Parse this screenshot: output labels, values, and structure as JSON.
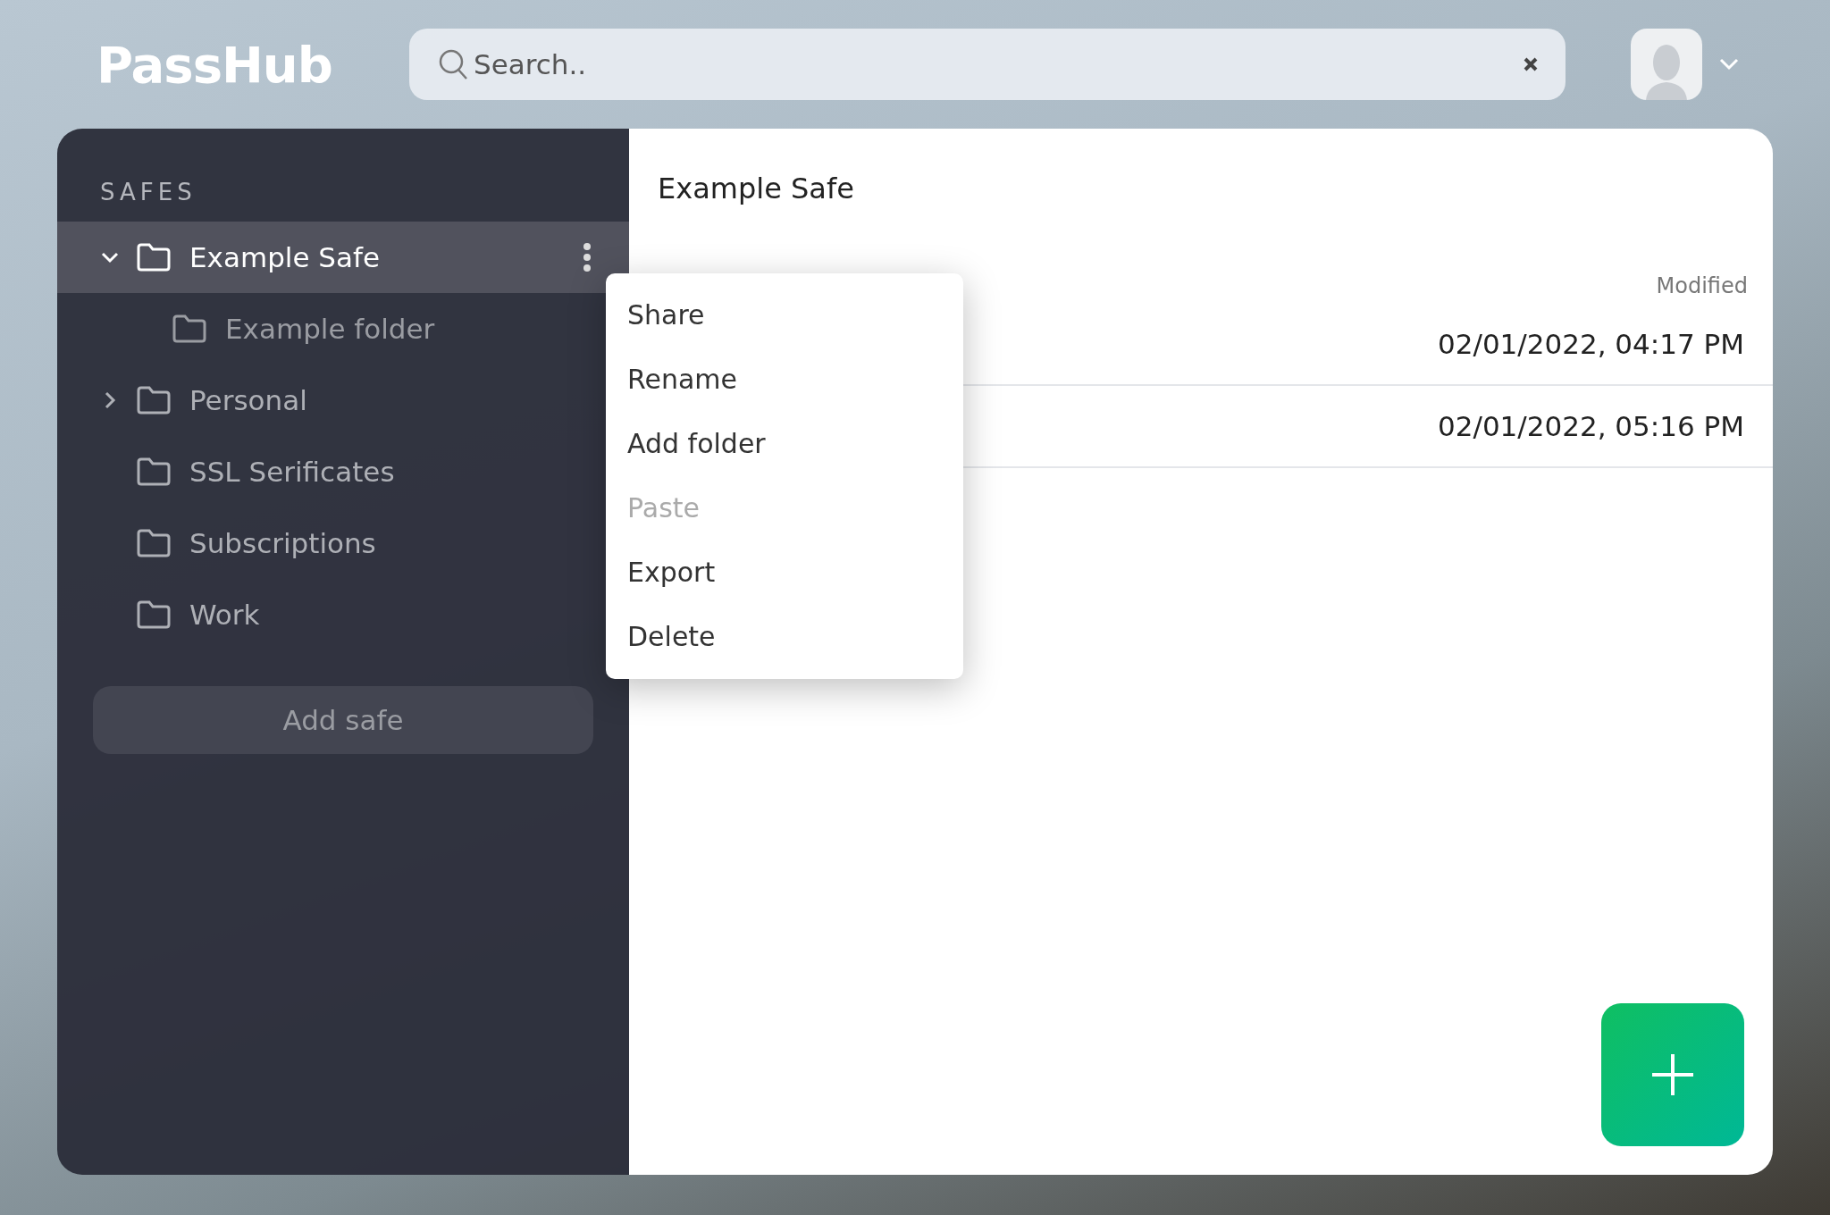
{
  "header": {
    "logo": "PassHub",
    "search": {
      "placeholder": "Search.."
    }
  },
  "sidebar": {
    "heading": "SAFES",
    "safes": [
      {
        "name": "Example Safe",
        "selected": true,
        "expanded": true,
        "children": [
          {
            "name": "Example folder",
            "selected": false
          }
        ]
      },
      {
        "name": "Personal",
        "selected": false,
        "expanded": false
      },
      {
        "name": "SSL Serificates",
        "selected": false
      },
      {
        "name": "Subscriptions",
        "selected": false
      },
      {
        "name": "Work",
        "selected": false
      }
    ],
    "add_button": "Add safe"
  },
  "content": {
    "title": "Example Safe",
    "columns": [
      "Modified"
    ],
    "rows": [
      {
        "modified": "02/01/2022, 04:17 PM"
      },
      {
        "modified": "02/01/2022, 05:16 PM"
      }
    ]
  },
  "context_menu": [
    {
      "label": "Share",
      "disabled": false
    },
    {
      "label": "Rename",
      "disabled": false
    },
    {
      "label": "Add folder",
      "disabled": false
    },
    {
      "label": "Paste",
      "disabled": true
    },
    {
      "label": "Export",
      "disabled": false
    },
    {
      "label": "Delete",
      "disabled": false
    }
  ]
}
